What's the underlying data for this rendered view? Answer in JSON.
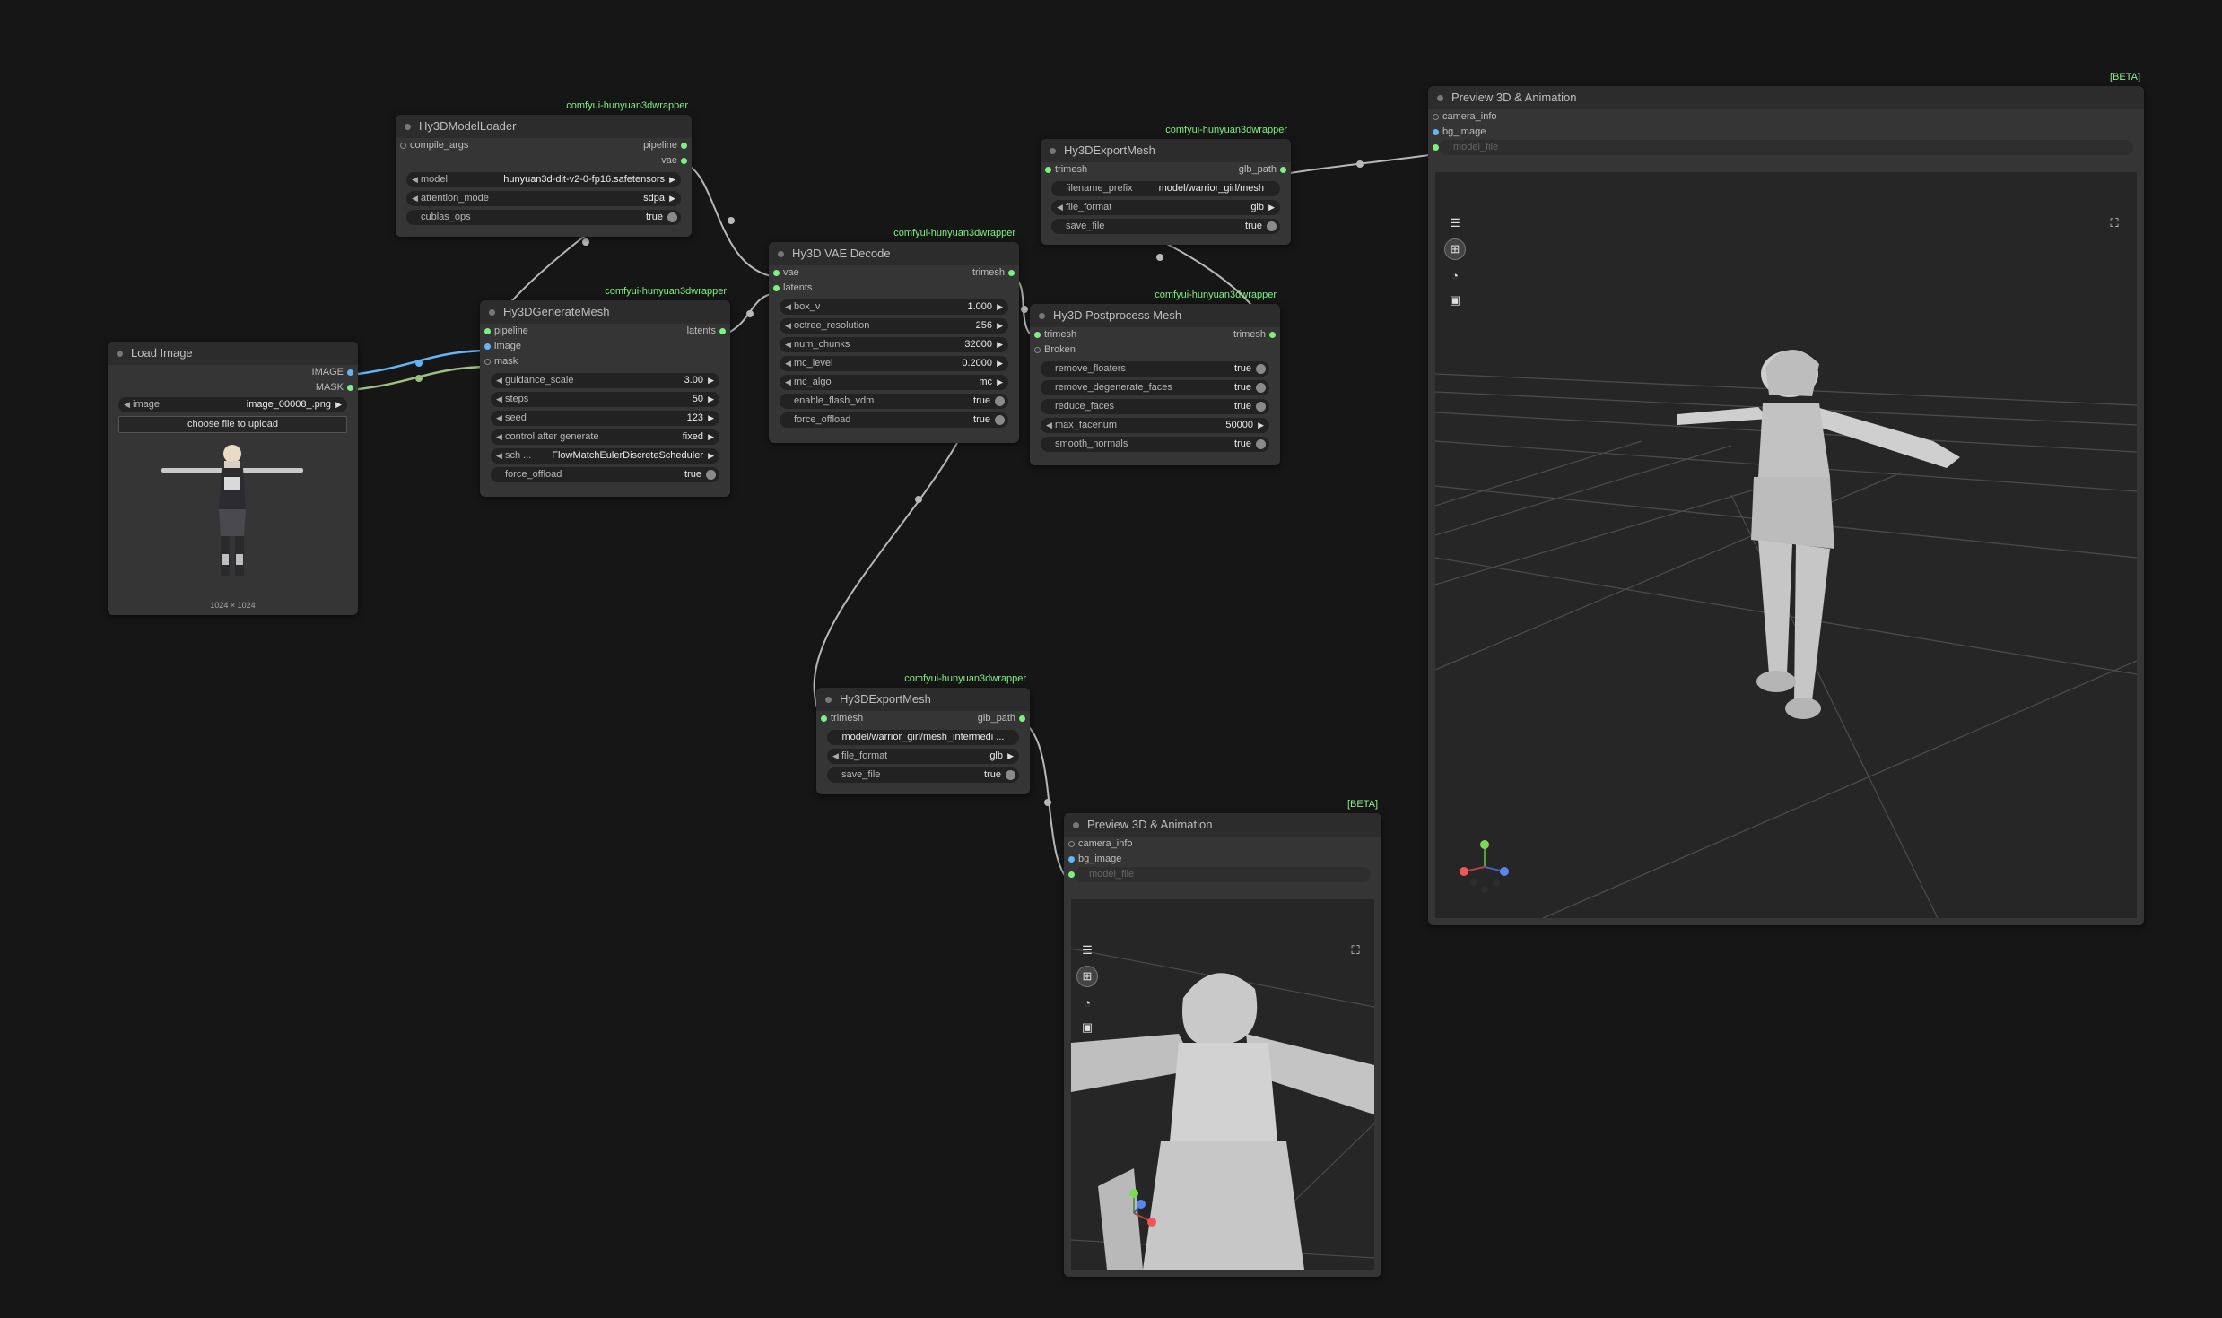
{
  "nodes": {
    "model_loader": {
      "title": "Hy3DModelLoader",
      "badge": "comfyui-hunyuan3dwrapper",
      "inputs": [
        "compile_args"
      ],
      "outputs": [
        "pipeline",
        "vae"
      ],
      "widgets": {
        "model": {
          "label": "model",
          "value": "hunyuan3d-dit-v2-0-fp16.safetensors"
        },
        "attention_mode": {
          "label": "attention_mode",
          "value": "sdpa"
        },
        "cublas_ops": {
          "label": "cublas_ops",
          "value": "true"
        }
      }
    },
    "load_image": {
      "title": "Load Image",
      "outputs": [
        "IMAGE",
        "MASK"
      ],
      "widgets": {
        "image": {
          "label": "image",
          "value": "image_00008_.png"
        },
        "upload": "choose file to upload"
      },
      "image_size": "1024 × 1024"
    },
    "generate_mesh": {
      "title": "Hy3DGenerateMesh",
      "badge": "comfyui-hunyuan3dwrapper",
      "inputs": [
        "pipeline",
        "image",
        "mask"
      ],
      "outputs": [
        "latents"
      ],
      "widgets": {
        "guidance_scale": {
          "label": "guidance_scale",
          "value": "3.00"
        },
        "steps": {
          "label": "steps",
          "value": "50"
        },
        "seed": {
          "label": "seed",
          "value": "123"
        },
        "control_after_generate": {
          "label": "control after generate",
          "value": "fixed"
        },
        "scheduler": {
          "label": "sch ...",
          "value": "FlowMatchEulerDiscreteScheduler"
        },
        "force_offload": {
          "label": "force_offload",
          "value": "true"
        }
      }
    },
    "vae_decode": {
      "title": "Hy3D VAE Decode",
      "badge": "comfyui-hunyuan3dwrapper",
      "inputs": [
        "vae",
        "latents"
      ],
      "outputs": [
        "trimesh"
      ],
      "widgets": {
        "box_v": {
          "label": "box_v",
          "value": "1.000"
        },
        "octree_resolution": {
          "label": "octree_resolution",
          "value": "256"
        },
        "num_chunks": {
          "label": "num_chunks",
          "value": "32000"
        },
        "mc_level": {
          "label": "mc_level",
          "value": "0.2000"
        },
        "mc_algo": {
          "label": "mc_algo",
          "value": "mc"
        },
        "enable_flash_vdm": {
          "label": "enable_flash_vdm",
          "value": "true"
        },
        "force_offload": {
          "label": "force_offload",
          "value": "true"
        }
      }
    },
    "export_mesh_top": {
      "title": "Hy3DExportMesh",
      "badge": "comfyui-hunyuan3dwrapper",
      "inputs": [
        "trimesh"
      ],
      "outputs": [
        "glb_path"
      ],
      "widgets": {
        "filename_prefix": {
          "label": "filename_prefix",
          "value": "model/warrior_girl/mesh"
        },
        "file_format": {
          "label": "file_format",
          "value": "glb"
        },
        "save_file": {
          "label": "save_file",
          "value": "true"
        }
      }
    },
    "postprocess": {
      "title": "Hy3D Postprocess Mesh",
      "badge": "comfyui-hunyuan3dwrapper",
      "inputs": [
        "trimesh",
        "Broken"
      ],
      "outputs": [
        "trimesh"
      ],
      "widgets": {
        "remove_floaters": {
          "label": "remove_floaters",
          "value": "true"
        },
        "remove_degenerate_faces": {
          "label": "remove_degenerate_faces",
          "value": "true"
        },
        "reduce_faces": {
          "label": "reduce_faces",
          "value": "true"
        },
        "max_facenum": {
          "label": "max_facenum",
          "value": "50000"
        },
        "smooth_normals": {
          "label": "smooth_normals",
          "value": "true"
        }
      }
    },
    "export_mesh_bottom": {
      "title": "Hy3DExportMesh",
      "badge": "comfyui-hunyuan3dwrapper",
      "inputs": [
        "trimesh"
      ],
      "outputs": [
        "glb_path"
      ],
      "widgets": {
        "filename_prefix": {
          "value": "model/warrior_girl/mesh_intermedi ..."
        },
        "file_format": {
          "label": "file_format",
          "value": "glb"
        },
        "save_file": {
          "label": "save_file",
          "value": "true"
        }
      }
    },
    "preview_top": {
      "title": "Preview 3D & Animation",
      "badge": "[BETA]",
      "inputs": [
        "camera_info",
        "bg_image",
        "model_file"
      ]
    },
    "preview_bottom": {
      "title": "Preview 3D & Animation",
      "badge": "[BETA]",
      "inputs": [
        "camera_info",
        "bg_image",
        "model_file"
      ]
    }
  },
  "icons": {
    "menu": "menu-icon",
    "grid": "grid-icon",
    "palette": "palette-icon",
    "image": "image-icon",
    "fullscreen": "fullscreen-icon"
  },
  "colors": {
    "background": "#161616",
    "node": "#353535",
    "badge": "#7ef07e",
    "link_gray": "#b8b8b8",
    "link_blue": "#64b5f6",
    "link_green": "#9bc07f"
  }
}
